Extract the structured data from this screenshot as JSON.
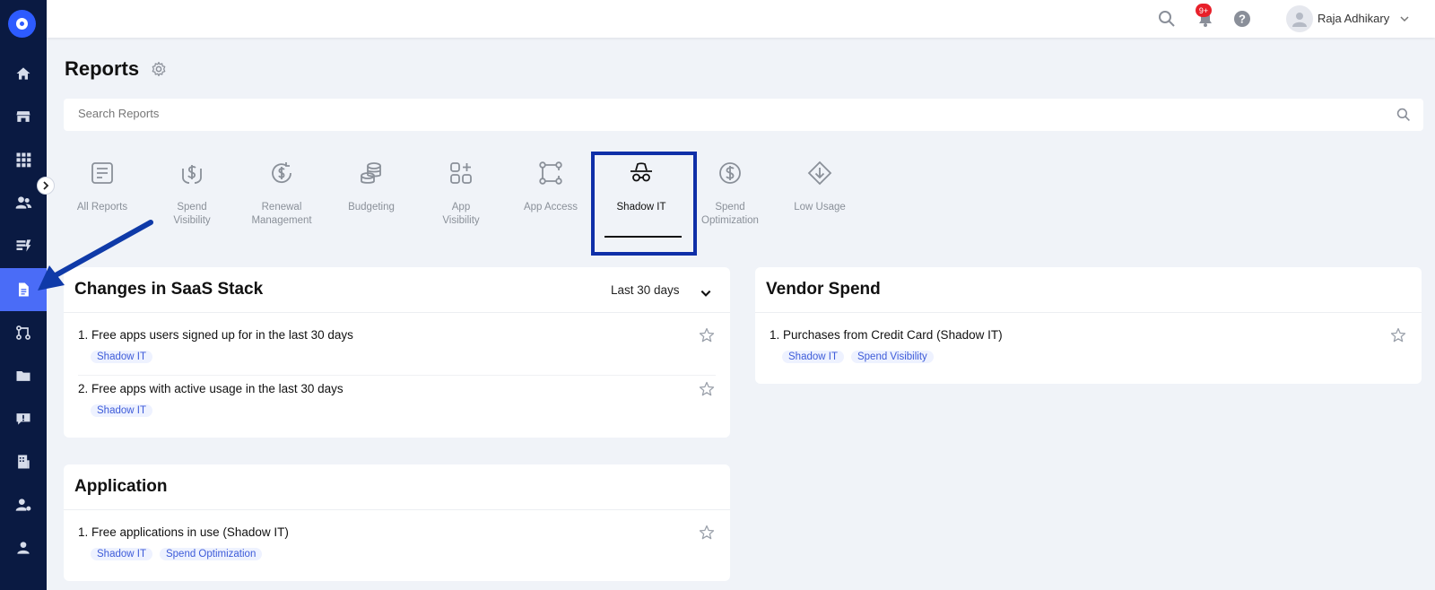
{
  "topbar": {
    "notification_count": "9+",
    "user_name": "Raja Adhikary"
  },
  "sidebar": {
    "items": [
      {
        "icon": "home-icon"
      },
      {
        "icon": "store-icon"
      },
      {
        "icon": "apps-grid-icon"
      },
      {
        "icon": "users-icon"
      },
      {
        "icon": "licenses-icon"
      },
      {
        "icon": "reports-icon",
        "active": true
      },
      {
        "icon": "workflow-icon"
      },
      {
        "icon": "folder-icon"
      },
      {
        "icon": "feedback-icon"
      },
      {
        "icon": "vendors-icon"
      },
      {
        "icon": "user-manage-icon"
      },
      {
        "icon": "profile-icon"
      }
    ]
  },
  "page": {
    "title": "Reports"
  },
  "search": {
    "placeholder": "Search Reports"
  },
  "categories": [
    {
      "label": "All Reports",
      "icon": "all-reports-icon"
    },
    {
      "label": "Spend\nVisibility",
      "icon": "spend-visibility-icon"
    },
    {
      "label": "Renewal\nManagement",
      "icon": "renewal-icon"
    },
    {
      "label": "Budgeting",
      "icon": "budgeting-icon"
    },
    {
      "label": "App\nVisibility",
      "icon": "app-visibility-icon"
    },
    {
      "label": "App Access",
      "icon": "app-access-icon"
    },
    {
      "label": "Shadow IT",
      "icon": "shadow-it-icon",
      "active": true
    },
    {
      "label": "Spend\nOptimization",
      "icon": "spend-optimization-icon"
    },
    {
      "label": "Low Usage",
      "icon": "low-usage-icon"
    }
  ],
  "cards": {
    "saas": {
      "title": "Changes in SaaS Stack",
      "range": "Last 30 days",
      "items": [
        {
          "title": "1. Free apps users signed up for in the last 30 days",
          "tags": [
            "Shadow IT"
          ]
        },
        {
          "title": "2. Free apps with active usage in the last 30 days",
          "tags": [
            "Shadow IT"
          ]
        }
      ]
    },
    "vendor": {
      "title": "Vendor Spend",
      "items": [
        {
          "title": "1. Purchases from Credit Card (Shadow IT)",
          "tags": [
            "Shadow IT",
            "Spend Visibility"
          ]
        }
      ]
    },
    "application": {
      "title": "Application",
      "items": [
        {
          "title": "1. Free applications in use (Shadow IT)",
          "tags": [
            "Shadow IT",
            "Spend Optimization"
          ]
        }
      ]
    }
  },
  "colors": {
    "sidebar_bg": "#0a1a42",
    "accent": "#4a6cf7",
    "highlight_border": "#0f2fa8",
    "tag_text": "#3d5bd9"
  }
}
